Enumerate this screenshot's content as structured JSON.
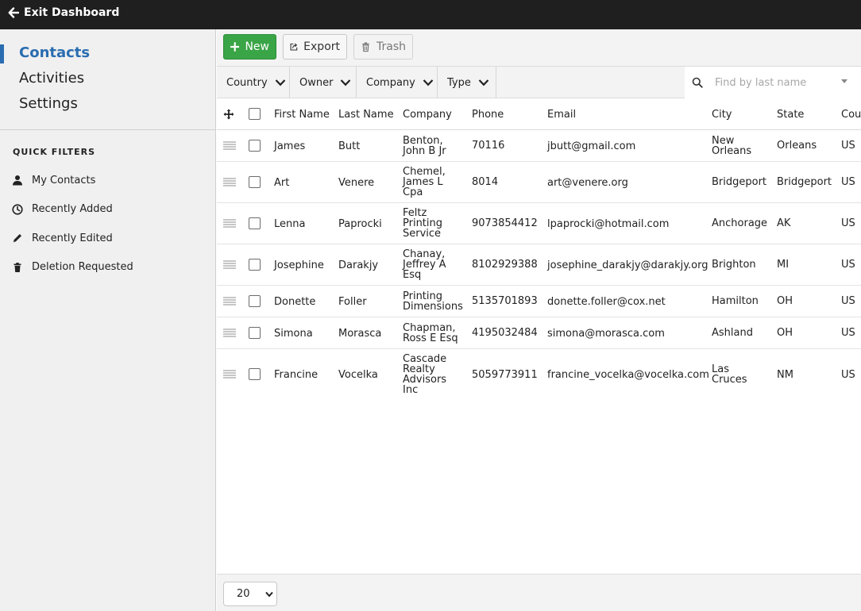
{
  "topbar": {
    "exit_label": "Exit Dashboard"
  },
  "sidebar": {
    "nav": [
      {
        "label": "Contacts",
        "active": true
      },
      {
        "label": "Activities",
        "active": false
      },
      {
        "label": "Settings",
        "active": false
      }
    ],
    "quick_filters_title": "QUICK FILTERS",
    "quick_filters": [
      {
        "label": "My Contacts",
        "icon": "user-icon"
      },
      {
        "label": "Recently Added",
        "icon": "clock-icon"
      },
      {
        "label": "Recently Edited",
        "icon": "pencil-icon"
      },
      {
        "label": "Deletion Requested",
        "icon": "trash-icon"
      }
    ]
  },
  "toolbar": {
    "new_label": "New",
    "export_label": "Export",
    "trash_label": "Trash"
  },
  "filters": {
    "country": "Country",
    "owner": "Owner",
    "company": "Company",
    "type": "Type"
  },
  "search": {
    "placeholder": "Find by last name"
  },
  "table": {
    "columns": [
      "First Name",
      "Last Name",
      "Company",
      "Phone",
      "Email",
      "City",
      "State",
      "Cou"
    ],
    "rows": [
      {
        "first": "James",
        "last": "Butt",
        "company": "Benton, John B Jr",
        "phone": "70116",
        "email": "jbutt@gmail.com",
        "city": "New Orleans",
        "state": "Orleans",
        "country": "US"
      },
      {
        "first": "Art",
        "last": "Venere",
        "company": "Chemel, James L Cpa",
        "phone": "8014",
        "email": "art@venere.org",
        "city": "Bridgeport",
        "state": "Bridgeport",
        "country": "US"
      },
      {
        "first": "Lenna",
        "last": "Paprocki",
        "company": "Feltz Printing Service",
        "phone": "9073854412",
        "email": "lpaprocki@hotmail.com",
        "city": "Anchorage",
        "state": "AK",
        "country": "US"
      },
      {
        "first": "Josephine",
        "last": "Darakjy",
        "company": "Chanay, Jeffrey A Esq",
        "phone": "8102929388",
        "email": "josephine_darakjy@darakjy.org",
        "city": "Brighton",
        "state": "MI",
        "country": "US"
      },
      {
        "first": "Donette",
        "last": "Foller",
        "company": "Printing Dimensions",
        "phone": "5135701893",
        "email": "donette.foller@cox.net",
        "city": "Hamilton",
        "state": "OH",
        "country": "US"
      },
      {
        "first": "Simona",
        "last": "Morasca",
        "company": "Chapman, Ross E Esq",
        "phone": "4195032484",
        "email": "simona@morasca.com",
        "city": "Ashland",
        "state": "OH",
        "country": "US"
      },
      {
        "first": "Francine",
        "last": "Vocelka",
        "company": "Cascade Realty Advisors Inc",
        "phone": "5059773911",
        "email": "francine_vocelka@vocelka.com",
        "city": "Las Cruces",
        "state": "NM",
        "country": "US"
      }
    ]
  },
  "footer": {
    "page_size": "20"
  }
}
